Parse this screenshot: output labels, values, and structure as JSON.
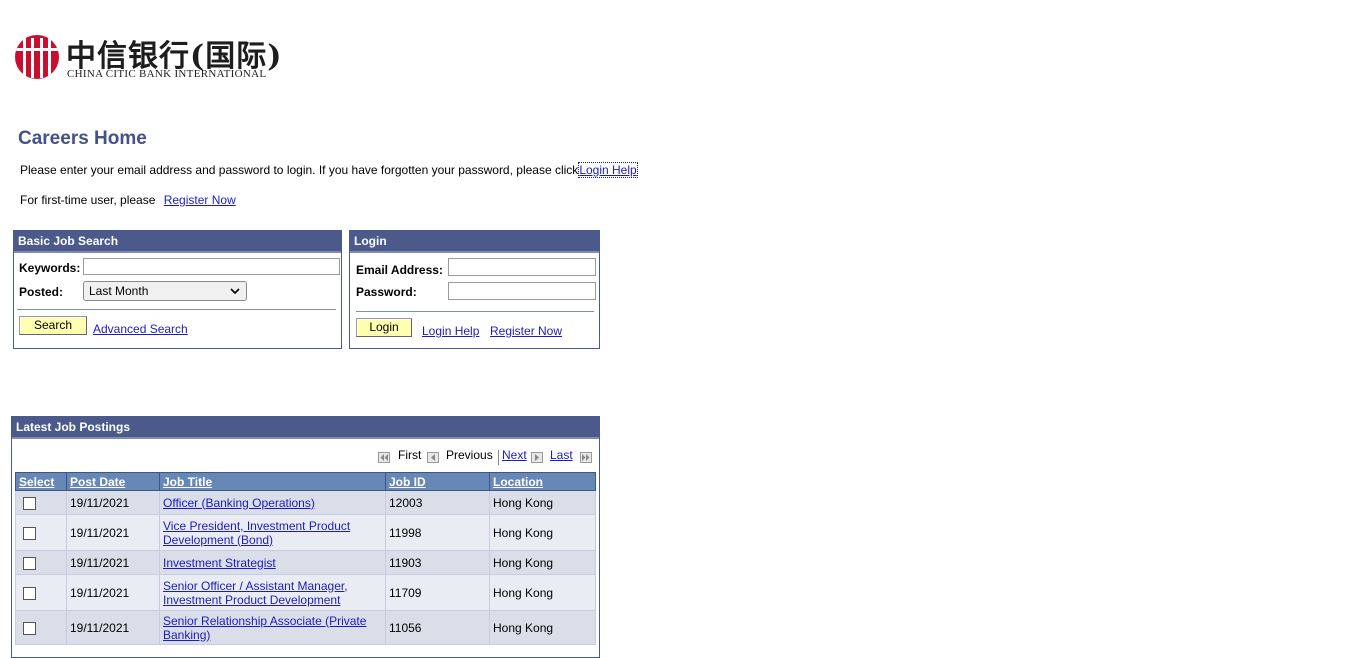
{
  "logo": {
    "chinese": "中信银行(国际)",
    "english": "CHINA CITIC BANK INTERNATIONAL",
    "brand_color": "#c8102e"
  },
  "page": {
    "title": "Careers Home",
    "intro_text": "Please enter your email address and password to login. If you have forgotten your password, please click",
    "login_help_link": "Login Help",
    "first_time_text": "For first-time user, please",
    "register_link": "Register Now"
  },
  "basic_search": {
    "header": "Basic Job Search",
    "keywords_label": "Keywords:",
    "keywords_value": "",
    "posted_label": "Posted:",
    "posted_selected": "Last Month",
    "search_button": "Search",
    "advanced_link": "Advanced Search"
  },
  "login": {
    "header": "Login",
    "email_label": "Email Address:",
    "email_value": "",
    "password_label": "Password:",
    "password_value": "",
    "login_button": "Login",
    "help_link": "Login Help",
    "register_link": "Register Now"
  },
  "postings": {
    "header": "Latest Job Postings",
    "nav": {
      "first": "First",
      "previous": "Previous",
      "next": "Next",
      "last": "Last"
    },
    "columns": [
      "Select",
      "Post Date",
      "Job Title",
      "Job ID",
      "Location"
    ],
    "rows": [
      {
        "post_date": "19/11/2021",
        "job_title": "Officer (Banking Operations)",
        "job_id": "12003",
        "location": "Hong Kong"
      },
      {
        "post_date": "19/11/2021",
        "job_title": "Vice President, Investment Product Development (Bond)",
        "job_id": "11998",
        "location": "Hong Kong"
      },
      {
        "post_date": "19/11/2021",
        "job_title": "Investment Strategist",
        "job_id": "11903",
        "location": "Hong Kong"
      },
      {
        "post_date": "19/11/2021",
        "job_title": "Senior Officer / Assistant Manager, Investment Product Development",
        "job_id": "11709",
        "location": "Hong Kong"
      },
      {
        "post_date": "19/11/2021",
        "job_title": "Senior Relationship Associate (Private Banking)",
        "job_id": "11056",
        "location": "Hong Kong"
      }
    ]
  }
}
